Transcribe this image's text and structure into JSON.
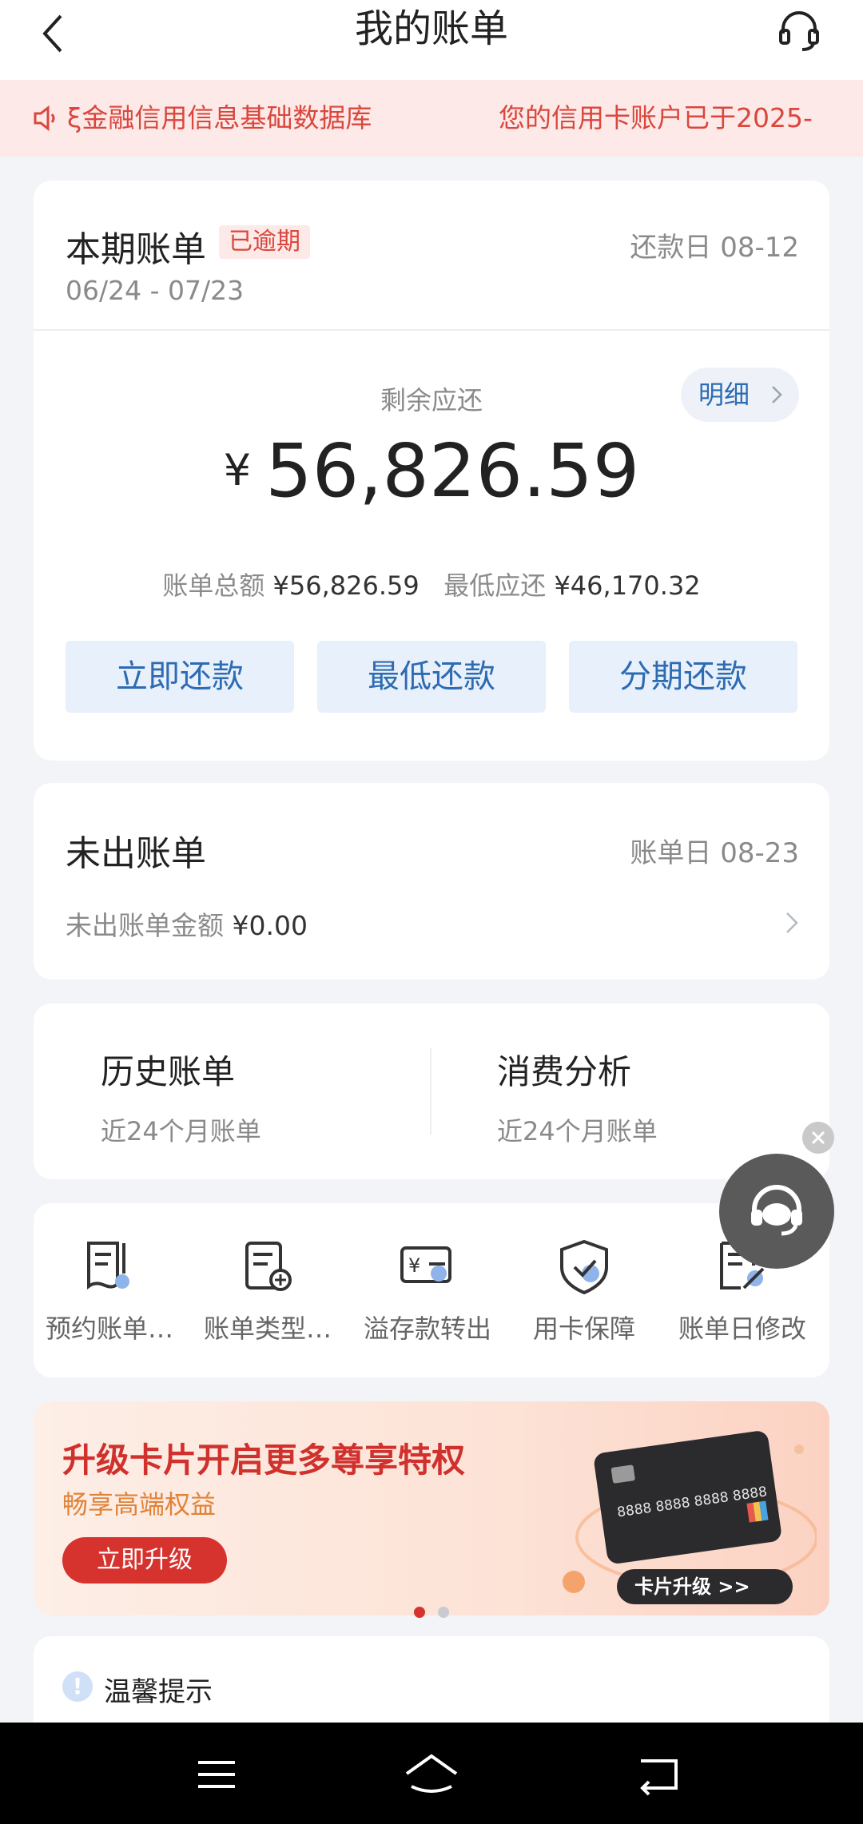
{
  "header": {
    "title": "我的账单",
    "back_icon": "back-arrow-icon",
    "service_icon": "headset-icon"
  },
  "notice": {
    "icon": "speaker-icon",
    "text_1": "ξ金融信用信息基础数据库",
    "text_2": "您的信用卡账户已于2025-"
  },
  "bill": {
    "title": "本期账单",
    "status": "已逾期",
    "due_date": "还款日 08-12",
    "period": "06/24 - 07/23",
    "remaining_label": "剩余应还",
    "detail_label": "明细",
    "currency": "¥",
    "amount": "56,826.59",
    "total_label": "账单总额",
    "total_value": "¥56,826.59",
    "min_label": "最低应还",
    "min_value": "¥46,170.32",
    "buttons": [
      "立即还款",
      "最低还款",
      "分期还款"
    ]
  },
  "unbilled": {
    "title": "未出账单",
    "bill_day": "账单日 08-23",
    "amount_label": "未出账单金额",
    "amount_value": "¥0.00"
  },
  "history": [
    {
      "title": "历史账单",
      "sub": "近24个月账单"
    },
    {
      "title": "消费分析",
      "sub": "近24个月账单"
    }
  ],
  "tools": [
    {
      "label": "预约账单…",
      "icon": "appointment-bill-icon"
    },
    {
      "label": "账单类型…",
      "icon": "bill-type-icon"
    },
    {
      "label": "溢存款转出",
      "icon": "deposit-transfer-icon"
    },
    {
      "label": "用卡保障",
      "icon": "card-protection-icon"
    },
    {
      "label": "账单日修改",
      "icon": "bill-date-edit-icon"
    }
  ],
  "banner": {
    "title": "升级卡片开启更多尊享特权",
    "subtitle": "畅享高端权益",
    "button": "立即升级",
    "card_number": "8888 8888 8888 8888",
    "card_tag": "卡片升级 >>"
  },
  "tips": {
    "title": "温馨提示",
    "icon": "info-icon"
  },
  "colors": {
    "accent": "#2d6bb3",
    "alert": "#d9473d",
    "background": "#f2f4f8"
  }
}
